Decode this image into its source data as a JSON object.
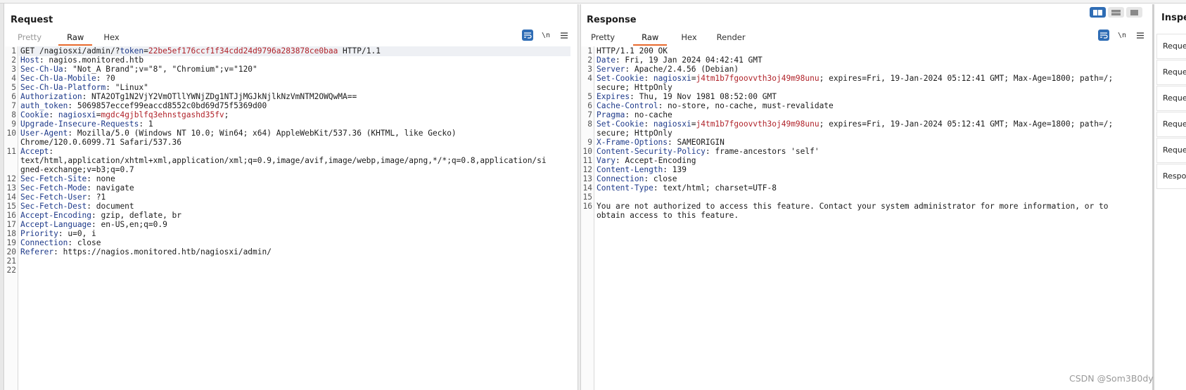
{
  "request": {
    "title": "Request",
    "tabs": [
      "Pretty",
      "Raw",
      "Hex"
    ],
    "active_tab": "Raw",
    "tools": {
      "wrap": "wrap-icon",
      "newline": "\\n",
      "menu": "menu-icon"
    },
    "lines": [
      [
        {
          "t": "GET /nagiosxi/admin/?"
        },
        {
          "t": "token",
          "c": "hk"
        },
        {
          "t": "="
        },
        {
          "t": "22be5ef176ccf1f34cdd24d9796a283878ce0baa",
          "c": "red"
        },
        {
          "t": " HTTP/1.1"
        }
      ],
      [
        {
          "t": "Host",
          "c": "hk"
        },
        {
          "t": ": nagios.monitored.htb"
        }
      ],
      [
        {
          "t": "Sec-Ch-Ua",
          "c": "hk"
        },
        {
          "t": ": \"Not_A Brand\";v=\"8\", \"Chromium\";v=\"120\""
        }
      ],
      [
        {
          "t": "Sec-Ch-Ua-Mobile",
          "c": "hk"
        },
        {
          "t": ": ?0"
        }
      ],
      [
        {
          "t": "Sec-Ch-Ua-Platform",
          "c": "hk"
        },
        {
          "t": ": \"Linux\""
        }
      ],
      [
        {
          "t": "Authorization",
          "c": "hk"
        },
        {
          "t": ": NTA2OTg1N2VjY2VmOTllYWNjZDg1NTJjMGJkNjlkNzVmNTM2OWQwMA=="
        }
      ],
      [
        {
          "t": "auth_token",
          "c": "hk"
        },
        {
          "t": ": 5069857eccef99eaccd8552c0bd69d75f5369d00"
        }
      ],
      [
        {
          "t": "Cookie",
          "c": "hk"
        },
        {
          "t": ": "
        },
        {
          "t": "nagiosxi",
          "c": "hk"
        },
        {
          "t": "="
        },
        {
          "t": "mgdc4gjblfq3ehnstgashd35fv",
          "c": "red"
        },
        {
          "t": ";"
        }
      ],
      [
        {
          "t": "Upgrade-Insecure-Requests",
          "c": "hk"
        },
        {
          "t": ": 1"
        }
      ],
      [
        {
          "t": "User-Agent",
          "c": "hk"
        },
        {
          "t": ": Mozilla/5.0 (Windows NT 10.0; Win64; x64) AppleWebKit/537.36 (KHTML, like Gecko)"
        }
      ],
      [
        {
          "t": "Chrome/120.0.6099.71 Safari/537.36"
        }
      ],
      [
        {
          "t": "Accept",
          "c": "hk"
        },
        {
          "t": ":"
        }
      ],
      [
        {
          "t": "text/html,application/xhtml+xml,application/xml;q=0.9,image/avif,image/webp,image/apng,*/*;q=0.8,application/si"
        }
      ],
      [
        {
          "t": "gned-exchange;v=b3;q=0.7"
        }
      ],
      [
        {
          "t": "Sec-Fetch-Site",
          "c": "hk"
        },
        {
          "t": ": none"
        }
      ],
      [
        {
          "t": "Sec-Fetch-Mode",
          "c": "hk"
        },
        {
          "t": ": navigate"
        }
      ],
      [
        {
          "t": "Sec-Fetch-User",
          "c": "hk"
        },
        {
          "t": ": ?1"
        }
      ],
      [
        {
          "t": "Sec-Fetch-Dest",
          "c": "hk"
        },
        {
          "t": ": document"
        }
      ],
      [
        {
          "t": "Accept-Encoding",
          "c": "hk"
        },
        {
          "t": ": gzip, deflate, br"
        }
      ],
      [
        {
          "t": "Accept-Language",
          "c": "hk"
        },
        {
          "t": ": en-US,en;q=0.9"
        }
      ],
      [
        {
          "t": "Priority",
          "c": "hk"
        },
        {
          "t": ": u=0, i"
        }
      ],
      [
        {
          "t": "Connection",
          "c": "hk"
        },
        {
          "t": ": close"
        }
      ],
      [
        {
          "t": "Referer",
          "c": "hk"
        },
        {
          "t": ": https://nagios.monitored.htb/nagiosxi/admin/"
        }
      ],
      [],
      []
    ],
    "line_numbers": [
      "1",
      "2",
      "3",
      "4",
      "5",
      "6",
      "7",
      "8",
      "9",
      "10",
      "",
      "11",
      "",
      "",
      "12",
      "13",
      "14",
      "15",
      "16",
      "17",
      "18",
      "19",
      "20",
      "21",
      "22"
    ]
  },
  "response": {
    "title": "Response",
    "tabs": [
      "Pretty",
      "Raw",
      "Hex",
      "Render"
    ],
    "active_tab": "Raw",
    "tools": {
      "wrap": "wrap-icon",
      "newline": "\\n",
      "menu": "menu-icon"
    },
    "lines": [
      [
        {
          "t": "HTTP/1.1 200 OK"
        }
      ],
      [
        {
          "t": "Date",
          "c": "hk"
        },
        {
          "t": ": Fri, 19 Jan 2024 04:42:41 GMT"
        }
      ],
      [
        {
          "t": "Server",
          "c": "hk"
        },
        {
          "t": ": Apache/2.4.56 (Debian)"
        }
      ],
      [
        {
          "t": "Set-Cookie",
          "c": "hk"
        },
        {
          "t": ": "
        },
        {
          "t": "nagiosxi",
          "c": "hk"
        },
        {
          "t": "="
        },
        {
          "t": "j4tm1b7fgoovvth3oj49m98unu",
          "c": "red"
        },
        {
          "t": "; expires=Fri, 19-Jan-2024 05:12:41 GMT; Max-Age=1800; path=/;"
        }
      ],
      [
        {
          "t": "secure; HttpOnly"
        }
      ],
      [
        {
          "t": "Expires",
          "c": "hk"
        },
        {
          "t": ": Thu, 19 Nov 1981 08:52:00 GMT"
        }
      ],
      [
        {
          "t": "Cache-Control",
          "c": "hk"
        },
        {
          "t": ": no-store, no-cache, must-revalidate"
        }
      ],
      [
        {
          "t": "Pragma",
          "c": "hk"
        },
        {
          "t": ": no-cache"
        }
      ],
      [
        {
          "t": "Set-Cookie",
          "c": "hk"
        },
        {
          "t": ": "
        },
        {
          "t": "nagiosxi",
          "c": "hk"
        },
        {
          "t": "="
        },
        {
          "t": "j4tm1b7fgoovvth3oj49m98unu",
          "c": "red"
        },
        {
          "t": "; expires=Fri, 19-Jan-2024 05:12:41 GMT; Max-Age=1800; path=/;"
        }
      ],
      [
        {
          "t": "secure; HttpOnly"
        }
      ],
      [
        {
          "t": "X-Frame-Options",
          "c": "hk"
        },
        {
          "t": ": SAMEORIGIN"
        }
      ],
      [
        {
          "t": "Content-Security-Policy",
          "c": "hk"
        },
        {
          "t": ": frame-ancestors 'self'"
        }
      ],
      [
        {
          "t": "Vary",
          "c": "hk"
        },
        {
          "t": ": Accept-Encoding"
        }
      ],
      [
        {
          "t": "Content-Length",
          "c": "hk"
        },
        {
          "t": ": 139"
        }
      ],
      [
        {
          "t": "Connection",
          "c": "hk"
        },
        {
          "t": ": close"
        }
      ],
      [
        {
          "t": "Content-Type",
          "c": "hk"
        },
        {
          "t": ": text/html; charset=UTF-8"
        }
      ],
      [],
      [
        {
          "t": "You are not authorized to access this feature. Contact your system administrator for more information, or to"
        }
      ],
      [
        {
          "t": "obtain access to this feature."
        }
      ]
    ],
    "line_numbers": [
      "1",
      "2",
      "3",
      "4",
      "",
      "5",
      "6",
      "7",
      "8",
      "",
      "9",
      "10",
      "11",
      "12",
      "13",
      "14",
      "15",
      "16",
      ""
    ]
  },
  "inspector": {
    "title": "Inspec",
    "items": [
      "Reques",
      "Reques",
      "Reques",
      "Reques",
      "Reques",
      "Respon"
    ]
  },
  "layout_switch": [
    "split-horizontal-icon",
    "split-vertical-icon",
    "tabs-icon"
  ],
  "watermark": "CSDN @Som3B0dy",
  "colors": {
    "accent_tab": "#e8692c",
    "header_key": "#1e3a8a",
    "value_red": "#b0232a",
    "button_blue": "#2f6db5"
  }
}
